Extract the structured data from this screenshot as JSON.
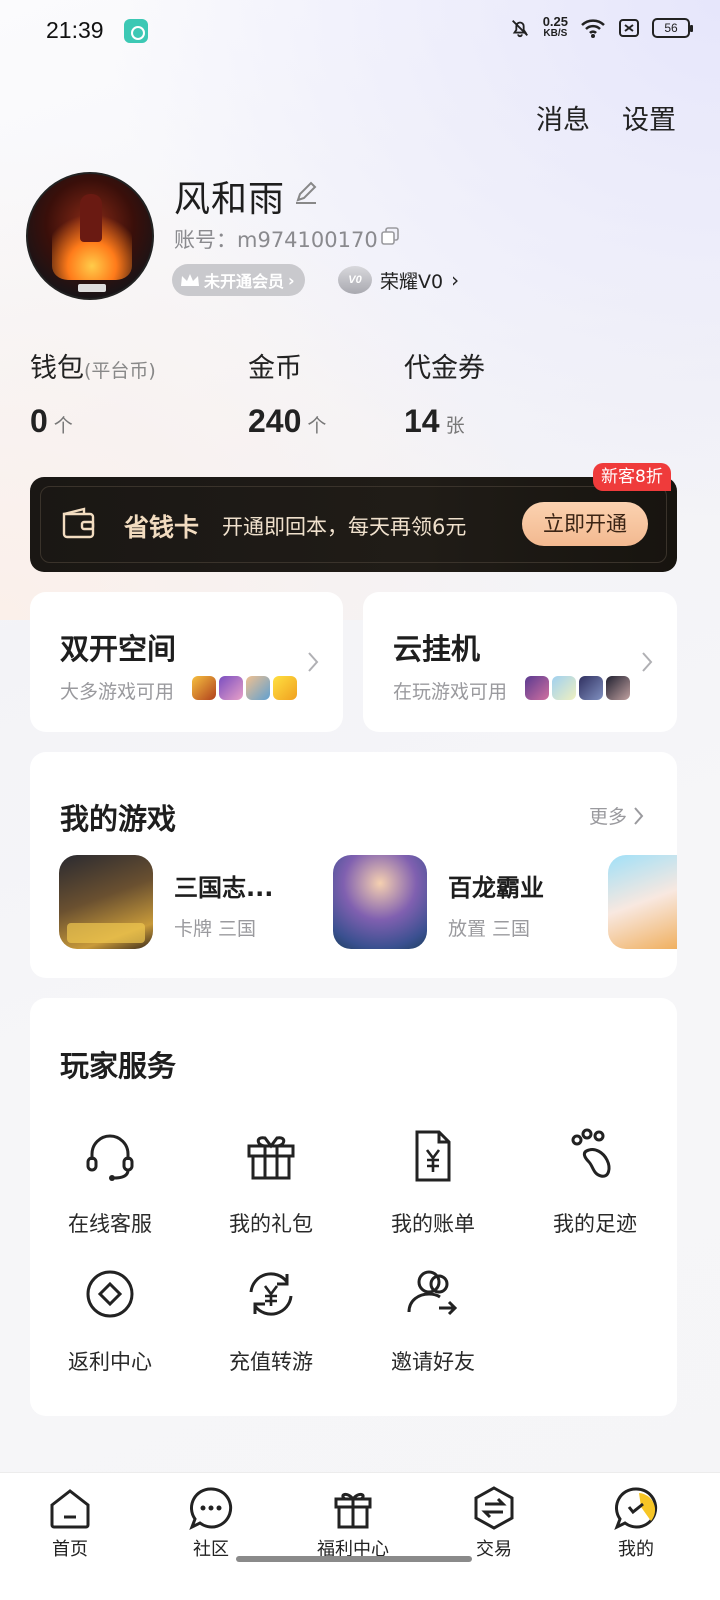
{
  "status": {
    "time": "21:39",
    "net_speed": "0.25",
    "net_unit": "KB/S",
    "battery": "56"
  },
  "top_actions": {
    "messages": "消息",
    "settings": "设置"
  },
  "profile": {
    "nickname": "风和雨",
    "account": "账号：m974100170",
    "vip": "未开通会员",
    "honor_badge": "V0",
    "honor": "荣耀V0"
  },
  "stats": [
    {
      "label": "钱包",
      "sub": "(平台币)",
      "value": "0",
      "unit": "个"
    },
    {
      "label": "金币",
      "sub": "",
      "value": "240",
      "unit": "个"
    },
    {
      "label": "代金券",
      "sub": "",
      "value": "14",
      "unit": "张"
    }
  ],
  "savings_card": {
    "title": "省钱卡",
    "desc": "开通即回本，每天再领6元",
    "button": "立即开通",
    "tag": "新客8折",
    "accent": "#f3b990"
  },
  "features": [
    {
      "title": "双开空间",
      "sub": "大多游戏可用"
    },
    {
      "title": "云挂机",
      "sub": "在玩游戏可用"
    }
  ],
  "my_games": {
    "title": "我的游戏",
    "more": "更多",
    "games": [
      {
        "name": "三国志...",
        "tags": "卡牌 三国"
      },
      {
        "name": "百龙霸业",
        "tags": "放置 三国"
      }
    ]
  },
  "services": {
    "title": "玩家服务",
    "items": [
      {
        "label": "在线客服",
        "icon": "headset-icon"
      },
      {
        "label": "我的礼包",
        "icon": "gift-icon"
      },
      {
        "label": "我的账单",
        "icon": "bill-icon"
      },
      {
        "label": "我的足迹",
        "icon": "footprint-icon"
      },
      {
        "label": "返利中心",
        "icon": "rebate-icon"
      },
      {
        "label": "充值转游",
        "icon": "recharge-transfer-icon"
      },
      {
        "label": "邀请好友",
        "icon": "invite-friends-icon"
      }
    ]
  },
  "bottom_nav": [
    {
      "label": "首页",
      "icon": "home-icon"
    },
    {
      "label": "社区",
      "icon": "community-icon"
    },
    {
      "label": "福利中心",
      "icon": "welfare-icon"
    },
    {
      "label": "交易",
      "icon": "trade-icon"
    },
    {
      "label": "我的",
      "icon": "mine-icon"
    }
  ]
}
